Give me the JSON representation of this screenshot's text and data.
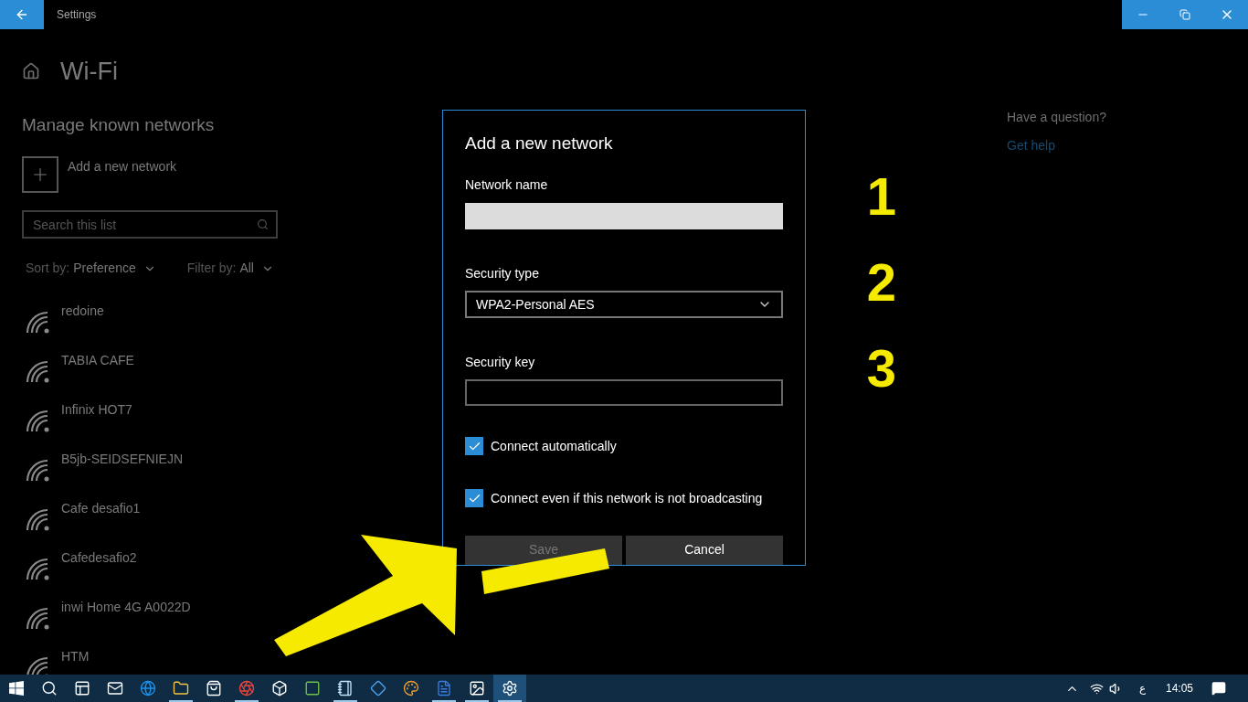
{
  "window": {
    "title": "Settings"
  },
  "page": {
    "title": "Wi-Fi",
    "section": "Manage known networks",
    "add_label": "Add a new network",
    "search": {
      "placeholder": "Search this list"
    },
    "sort": {
      "label": "Sort by:",
      "value": "Preference"
    },
    "filter": {
      "label": "Filter by:",
      "value": "All"
    },
    "networks": [
      {
        "name": "redoine"
      },
      {
        "name": "TABIA CAFE"
      },
      {
        "name": "Infinix HOT7"
      },
      {
        "name": "B5jb-SEIDSEFNIEJN"
      },
      {
        "name": "Cafe desafio1"
      },
      {
        "name": "Cafedesafio2"
      },
      {
        "name": "inwi Home 4G A0022D"
      },
      {
        "name": "HTM"
      }
    ]
  },
  "help": {
    "question": "Have a question?",
    "link": "Get help"
  },
  "dialog": {
    "title": "Add a new network",
    "name_field": {
      "label": "Network name",
      "focused": true
    },
    "security_type": {
      "label": "Security type",
      "value": "WPA2-Personal AES"
    },
    "key_field": {
      "label": "Security key",
      "focused": false
    },
    "checkboxes": [
      {
        "label": "Connect automatically",
        "checked": true
      },
      {
        "label": "Connect even if this network is not broadcasting",
        "checked": true
      }
    ],
    "buttons": [
      {
        "label": "Save",
        "disabled": true
      },
      {
        "label": "Cancel",
        "disabled": false
      }
    ]
  },
  "annotations": [
    {
      "label": "1"
    },
    {
      "label": "2"
    },
    {
      "label": "3"
    }
  ],
  "taskbar": {
    "apps": [
      {
        "kind": "start",
        "open": false,
        "selected": false
      },
      {
        "kind": "search",
        "open": false,
        "selected": false
      },
      {
        "kind": "taskview",
        "open": false,
        "selected": false
      },
      {
        "kind": "mail",
        "open": false,
        "selected": false
      },
      {
        "kind": "browser",
        "open": false,
        "selected": false
      },
      {
        "kind": "folder",
        "open": true,
        "selected": false
      },
      {
        "kind": "store",
        "open": false,
        "selected": false
      },
      {
        "kind": "chrome",
        "open": true,
        "selected": false
      },
      {
        "kind": "box",
        "open": false,
        "selected": false
      },
      {
        "kind": "recorder",
        "open": false,
        "selected": false
      },
      {
        "kind": "notepad",
        "open": true,
        "selected": false
      },
      {
        "kind": "diamond",
        "open": false,
        "selected": false
      },
      {
        "kind": "paint",
        "open": false,
        "selected": false
      },
      {
        "kind": "word",
        "open": true,
        "selected": false
      },
      {
        "kind": "photos",
        "open": true,
        "selected": false
      },
      {
        "kind": "settings",
        "open": true,
        "selected": true
      }
    ],
    "language": "ع",
    "time": "14:05"
  }
}
